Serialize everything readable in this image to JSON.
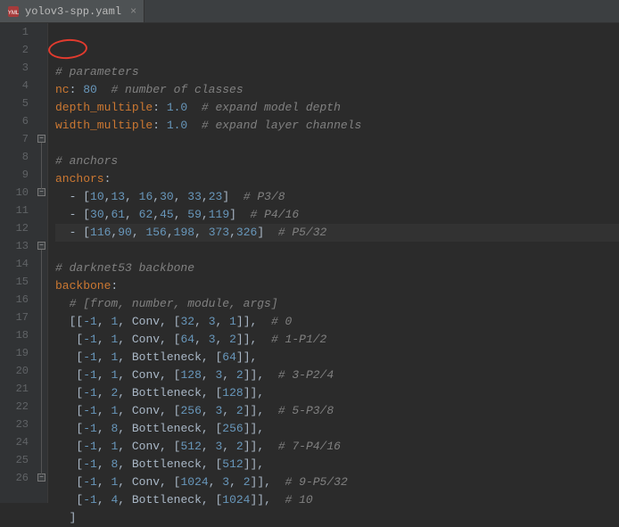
{
  "tab": {
    "filename": "yolov3-spp.yaml",
    "icon_label": "YML"
  },
  "gutter": {
    "start": 1,
    "end": 26
  },
  "code_lines": [
    {
      "n": 1,
      "segs": [
        {
          "t": "# parameters",
          "c": "tok-comment"
        }
      ]
    },
    {
      "n": 2,
      "segs": [
        {
          "t": "nc",
          "c": "tok-key"
        },
        {
          "t": ": ",
          "c": "tok-str"
        },
        {
          "t": "80",
          "c": "tok-num"
        },
        {
          "t": "  ",
          "c": "tok-str"
        },
        {
          "t": "# number of classes",
          "c": "tok-comment"
        }
      ]
    },
    {
      "n": 3,
      "segs": [
        {
          "t": "depth_multiple",
          "c": "tok-key"
        },
        {
          "t": ": ",
          "c": "tok-str"
        },
        {
          "t": "1.0",
          "c": "tok-num"
        },
        {
          "t": "  ",
          "c": "tok-str"
        },
        {
          "t": "# expand model depth",
          "c": "tok-comment"
        }
      ]
    },
    {
      "n": 4,
      "segs": [
        {
          "t": "width_multiple",
          "c": "tok-key"
        },
        {
          "t": ": ",
          "c": "tok-str"
        },
        {
          "t": "1.0",
          "c": "tok-num"
        },
        {
          "t": "  ",
          "c": "tok-str"
        },
        {
          "t": "# expand layer channels",
          "c": "tok-comment"
        }
      ]
    },
    {
      "n": 5,
      "segs": []
    },
    {
      "n": 6,
      "segs": [
        {
          "t": "# anchors",
          "c": "tok-comment"
        }
      ]
    },
    {
      "n": 7,
      "segs": [
        {
          "t": "anchors",
          "c": "tok-key"
        },
        {
          "t": ":",
          "c": "tok-str"
        }
      ]
    },
    {
      "n": 8,
      "segs": [
        {
          "t": "  - [",
          "c": "tok-bracket"
        },
        {
          "t": "10",
          "c": "tok-num"
        },
        {
          "t": ",",
          "c": "tok-str"
        },
        {
          "t": "13",
          "c": "tok-num"
        },
        {
          "t": ", ",
          "c": "tok-str"
        },
        {
          "t": "16",
          "c": "tok-num"
        },
        {
          "t": ",",
          "c": "tok-str"
        },
        {
          "t": "30",
          "c": "tok-num"
        },
        {
          "t": ", ",
          "c": "tok-str"
        },
        {
          "t": "33",
          "c": "tok-num"
        },
        {
          "t": ",",
          "c": "tok-str"
        },
        {
          "t": "23",
          "c": "tok-num"
        },
        {
          "t": "]  ",
          "c": "tok-bracket"
        },
        {
          "t": "# P3/8",
          "c": "tok-comment"
        }
      ]
    },
    {
      "n": 9,
      "segs": [
        {
          "t": "  - [",
          "c": "tok-bracket"
        },
        {
          "t": "30",
          "c": "tok-num"
        },
        {
          "t": ",",
          "c": "tok-str"
        },
        {
          "t": "61",
          "c": "tok-num"
        },
        {
          "t": ", ",
          "c": "tok-str"
        },
        {
          "t": "62",
          "c": "tok-num"
        },
        {
          "t": ",",
          "c": "tok-str"
        },
        {
          "t": "45",
          "c": "tok-num"
        },
        {
          "t": ", ",
          "c": "tok-str"
        },
        {
          "t": "59",
          "c": "tok-num"
        },
        {
          "t": ",",
          "c": "tok-str"
        },
        {
          "t": "119",
          "c": "tok-num"
        },
        {
          "t": "]  ",
          "c": "tok-bracket"
        },
        {
          "t": "# P4/16",
          "c": "tok-comment"
        }
      ]
    },
    {
      "n": 10,
      "current": true,
      "segs": [
        {
          "t": "  - [",
          "c": "tok-bracket"
        },
        {
          "t": "116",
          "c": "tok-num"
        },
        {
          "t": ",",
          "c": "tok-str"
        },
        {
          "t": "90",
          "c": "tok-num"
        },
        {
          "t": ", ",
          "c": "tok-str"
        },
        {
          "t": "156",
          "c": "tok-num"
        },
        {
          "t": ",",
          "c": "tok-str"
        },
        {
          "t": "198",
          "c": "tok-num"
        },
        {
          "t": ", ",
          "c": "tok-str"
        },
        {
          "t": "373",
          "c": "tok-num"
        },
        {
          "t": ",",
          "c": "tok-str"
        },
        {
          "t": "326",
          "c": "tok-num"
        },
        {
          "t": "]  ",
          "c": "tok-bracket"
        },
        {
          "t": "# P5/32",
          "c": "tok-comment"
        }
      ]
    },
    {
      "n": 11,
      "segs": []
    },
    {
      "n": 12,
      "segs": [
        {
          "t": "# darknet53 backbone",
          "c": "tok-comment"
        }
      ]
    },
    {
      "n": 13,
      "segs": [
        {
          "t": "backbone",
          "c": "tok-key"
        },
        {
          "t": ":",
          "c": "tok-str"
        }
      ]
    },
    {
      "n": 14,
      "segs": [
        {
          "t": "  ",
          "c": "tok-str"
        },
        {
          "t": "# [from, number, module, args]",
          "c": "tok-comment"
        }
      ]
    },
    {
      "n": 15,
      "segs": [
        {
          "t": "  [[",
          "c": "tok-bracket"
        },
        {
          "t": "-1",
          "c": "tok-num"
        },
        {
          "t": ", ",
          "c": "tok-str"
        },
        {
          "t": "1",
          "c": "tok-num"
        },
        {
          "t": ", Conv, [",
          "c": "tok-ident"
        },
        {
          "t": "32",
          "c": "tok-num"
        },
        {
          "t": ", ",
          "c": "tok-str"
        },
        {
          "t": "3",
          "c": "tok-num"
        },
        {
          "t": ", ",
          "c": "tok-str"
        },
        {
          "t": "1",
          "c": "tok-num"
        },
        {
          "t": "]],  ",
          "c": "tok-bracket"
        },
        {
          "t": "# 0",
          "c": "tok-comment"
        }
      ]
    },
    {
      "n": 16,
      "segs": [
        {
          "t": "   [",
          "c": "tok-bracket"
        },
        {
          "t": "-1",
          "c": "tok-num"
        },
        {
          "t": ", ",
          "c": "tok-str"
        },
        {
          "t": "1",
          "c": "tok-num"
        },
        {
          "t": ", Conv, [",
          "c": "tok-ident"
        },
        {
          "t": "64",
          "c": "tok-num"
        },
        {
          "t": ", ",
          "c": "tok-str"
        },
        {
          "t": "3",
          "c": "tok-num"
        },
        {
          "t": ", ",
          "c": "tok-str"
        },
        {
          "t": "2",
          "c": "tok-num"
        },
        {
          "t": "]],  ",
          "c": "tok-bracket"
        },
        {
          "t": "# 1-P1/2",
          "c": "tok-comment"
        }
      ]
    },
    {
      "n": 17,
      "segs": [
        {
          "t": "   [",
          "c": "tok-bracket"
        },
        {
          "t": "-1",
          "c": "tok-num"
        },
        {
          "t": ", ",
          "c": "tok-str"
        },
        {
          "t": "1",
          "c": "tok-num"
        },
        {
          "t": ", Bottleneck, [",
          "c": "tok-ident"
        },
        {
          "t": "64",
          "c": "tok-num"
        },
        {
          "t": "]],",
          "c": "tok-bracket"
        }
      ]
    },
    {
      "n": 18,
      "segs": [
        {
          "t": "   [",
          "c": "tok-bracket"
        },
        {
          "t": "-1",
          "c": "tok-num"
        },
        {
          "t": ", ",
          "c": "tok-str"
        },
        {
          "t": "1",
          "c": "tok-num"
        },
        {
          "t": ", Conv, [",
          "c": "tok-ident"
        },
        {
          "t": "128",
          "c": "tok-num"
        },
        {
          "t": ", ",
          "c": "tok-str"
        },
        {
          "t": "3",
          "c": "tok-num"
        },
        {
          "t": ", ",
          "c": "tok-str"
        },
        {
          "t": "2",
          "c": "tok-num"
        },
        {
          "t": "]],  ",
          "c": "tok-bracket"
        },
        {
          "t": "# 3-P2/4",
          "c": "tok-comment"
        }
      ]
    },
    {
      "n": 19,
      "segs": [
        {
          "t": "   [",
          "c": "tok-bracket"
        },
        {
          "t": "-1",
          "c": "tok-num"
        },
        {
          "t": ", ",
          "c": "tok-str"
        },
        {
          "t": "2",
          "c": "tok-num"
        },
        {
          "t": ", Bottleneck, [",
          "c": "tok-ident"
        },
        {
          "t": "128",
          "c": "tok-num"
        },
        {
          "t": "]],",
          "c": "tok-bracket"
        }
      ]
    },
    {
      "n": 20,
      "segs": [
        {
          "t": "   [",
          "c": "tok-bracket"
        },
        {
          "t": "-1",
          "c": "tok-num"
        },
        {
          "t": ", ",
          "c": "tok-str"
        },
        {
          "t": "1",
          "c": "tok-num"
        },
        {
          "t": ", Conv, [",
          "c": "tok-ident"
        },
        {
          "t": "256",
          "c": "tok-num"
        },
        {
          "t": ", ",
          "c": "tok-str"
        },
        {
          "t": "3",
          "c": "tok-num"
        },
        {
          "t": ", ",
          "c": "tok-str"
        },
        {
          "t": "2",
          "c": "tok-num"
        },
        {
          "t": "]],  ",
          "c": "tok-bracket"
        },
        {
          "t": "# 5-P3/8",
          "c": "tok-comment"
        }
      ]
    },
    {
      "n": 21,
      "segs": [
        {
          "t": "   [",
          "c": "tok-bracket"
        },
        {
          "t": "-1",
          "c": "tok-num"
        },
        {
          "t": ", ",
          "c": "tok-str"
        },
        {
          "t": "8",
          "c": "tok-num"
        },
        {
          "t": ", Bottleneck, [",
          "c": "tok-ident"
        },
        {
          "t": "256",
          "c": "tok-num"
        },
        {
          "t": "]],",
          "c": "tok-bracket"
        }
      ]
    },
    {
      "n": 22,
      "segs": [
        {
          "t": "   [",
          "c": "tok-bracket"
        },
        {
          "t": "-1",
          "c": "tok-num"
        },
        {
          "t": ", ",
          "c": "tok-str"
        },
        {
          "t": "1",
          "c": "tok-num"
        },
        {
          "t": ", Conv, [",
          "c": "tok-ident"
        },
        {
          "t": "512",
          "c": "tok-num"
        },
        {
          "t": ", ",
          "c": "tok-str"
        },
        {
          "t": "3",
          "c": "tok-num"
        },
        {
          "t": ", ",
          "c": "tok-str"
        },
        {
          "t": "2",
          "c": "tok-num"
        },
        {
          "t": "]],  ",
          "c": "tok-bracket"
        },
        {
          "t": "# 7-P4/16",
          "c": "tok-comment"
        }
      ]
    },
    {
      "n": 23,
      "segs": [
        {
          "t": "   [",
          "c": "tok-bracket"
        },
        {
          "t": "-1",
          "c": "tok-num"
        },
        {
          "t": ", ",
          "c": "tok-str"
        },
        {
          "t": "8",
          "c": "tok-num"
        },
        {
          "t": ", Bottleneck, [",
          "c": "tok-ident"
        },
        {
          "t": "512",
          "c": "tok-num"
        },
        {
          "t": "]],",
          "c": "tok-bracket"
        }
      ]
    },
    {
      "n": 24,
      "segs": [
        {
          "t": "   [",
          "c": "tok-bracket"
        },
        {
          "t": "-1",
          "c": "tok-num"
        },
        {
          "t": ", ",
          "c": "tok-str"
        },
        {
          "t": "1",
          "c": "tok-num"
        },
        {
          "t": ", Conv, [",
          "c": "tok-ident"
        },
        {
          "t": "1024",
          "c": "tok-num"
        },
        {
          "t": ", ",
          "c": "tok-str"
        },
        {
          "t": "3",
          "c": "tok-num"
        },
        {
          "t": ", ",
          "c": "tok-str"
        },
        {
          "t": "2",
          "c": "tok-num"
        },
        {
          "t": "]],  ",
          "c": "tok-bracket"
        },
        {
          "t": "# 9-P5/32",
          "c": "tok-comment"
        }
      ]
    },
    {
      "n": 25,
      "segs": [
        {
          "t": "   [",
          "c": "tok-bracket"
        },
        {
          "t": "-1",
          "c": "tok-num"
        },
        {
          "t": ", ",
          "c": "tok-str"
        },
        {
          "t": "4",
          "c": "tok-num"
        },
        {
          "t": ", Bottleneck, [",
          "c": "tok-ident"
        },
        {
          "t": "1024",
          "c": "tok-num"
        },
        {
          "t": "]],  ",
          "c": "tok-bracket"
        },
        {
          "t": "# 10",
          "c": "tok-comment"
        }
      ]
    },
    {
      "n": 26,
      "segs": [
        {
          "t": "  ]",
          "c": "tok-bracket"
        }
      ]
    }
  ],
  "fold_marks": [
    {
      "line": 7,
      "kind": "open"
    },
    {
      "line": 10,
      "kind": "close"
    },
    {
      "line": 13,
      "kind": "open"
    },
    {
      "line": 26,
      "kind": "close"
    }
  ],
  "annotation": {
    "target_line": 2,
    "description": "red circle highlighting nc: 80"
  }
}
